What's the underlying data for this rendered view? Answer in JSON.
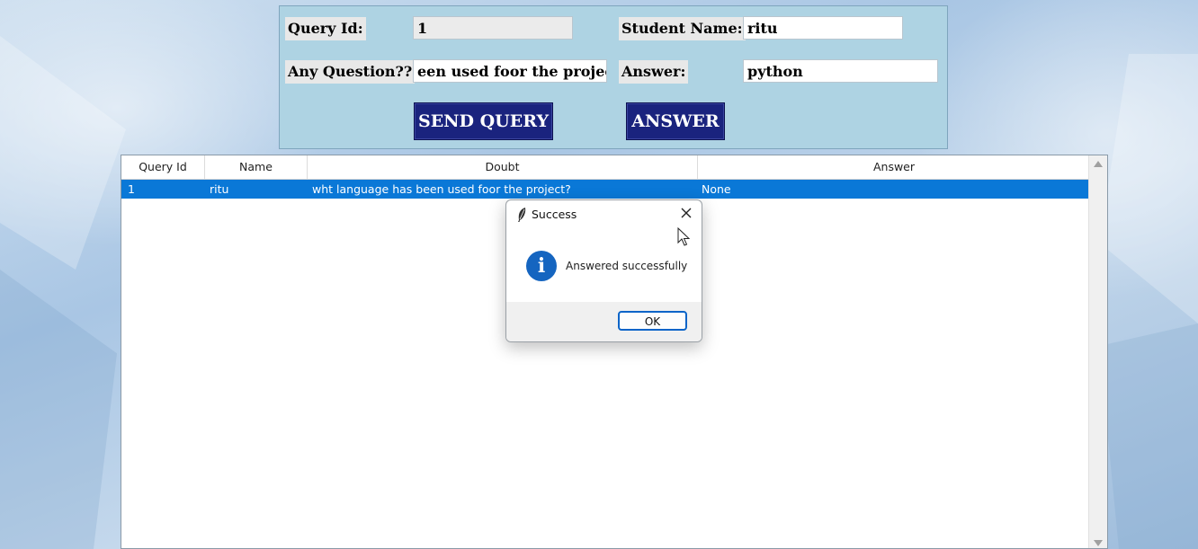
{
  "form": {
    "query_id_label": "Query Id:",
    "query_id_value": "1",
    "student_name_label": "Student Name:",
    "student_name_value": "ritu",
    "question_label": "Any Question??",
    "question_value": "een used foor the project?",
    "answer_label": "Answer:",
    "answer_value": "python",
    "send_query_button": "SEND QUERY",
    "answer_button": "ANSWER"
  },
  "table": {
    "columns": [
      "Query Id",
      "Name",
      "Doubt",
      "Answer"
    ],
    "rows": [
      {
        "query_id": "1",
        "name": "ritu",
        "doubt": "wht language has been used foor the project?",
        "answer": "None"
      }
    ],
    "selected_row_color": "#0a78d7"
  },
  "dialog": {
    "title": "Success",
    "message": "Answered successfully",
    "ok_label": "OK",
    "icon": "info-icon"
  },
  "colors": {
    "panel_bg": "#aed3e3",
    "button_bg": "#1a237e",
    "info_blue": "#1565c0"
  }
}
